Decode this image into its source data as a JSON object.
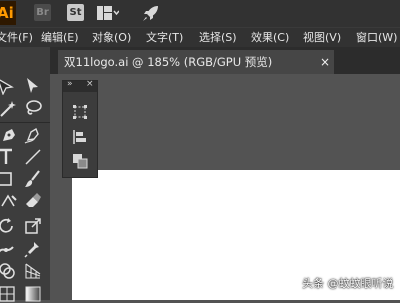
{
  "app": {
    "logo_text": "Ai",
    "bridge_label": "Br",
    "stock_label": "St"
  },
  "menu": [
    "文件(F)",
    "编辑(E)",
    "对象(O)",
    "文字(T)",
    "选择(S)",
    "效果(C)",
    "视图(V)",
    "窗口(W)"
  ],
  "document_tab": {
    "title": "双11logo.ai @ 185% (RGB/GPU 预览)",
    "close": "×"
  },
  "panel": {
    "collapse": "»",
    "close": "×"
  },
  "watermark": "头条 @蚊蚊眼听说",
  "colors": {
    "accent": "#ff9a00",
    "ui_dark": "#323232",
    "canvas_bg": "#535353",
    "artboard": "#ffffff"
  },
  "icons": [
    "selection-tool-icon",
    "direct-selection-tool-icon",
    "magic-wand-icon",
    "lasso-icon",
    "pen-tool-icon",
    "curvature-tool-icon",
    "type-tool-icon",
    "line-tool-icon",
    "rectangle-tool-icon",
    "paintbrush-tool-icon",
    "shaper-tool-icon",
    "eraser-tool-icon",
    "rotate-tool-icon",
    "scale-tool-icon",
    "width-tool-icon",
    "puppet-warp-icon",
    "shape-builder-icon",
    "perspective-grid-icon",
    "transform-panel-icon",
    "align-panel-icon",
    "pathfinder-panel-icon"
  ]
}
